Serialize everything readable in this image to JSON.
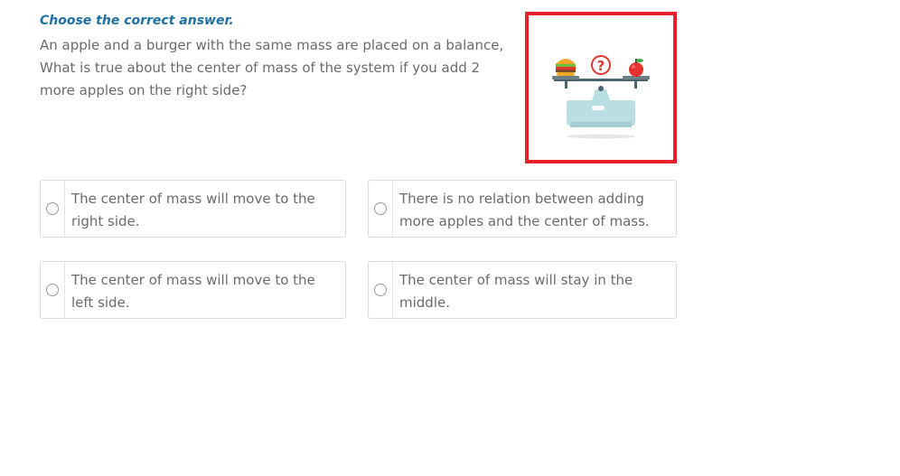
{
  "question": {
    "instruction": "Choose the correct answer.",
    "text": "An apple and a burger with the same mass are placed on a balance, What is true about the center of mass of the system if you add 2 more apples on the right side?",
    "image_icon": "balance-scale-burger-apple-question",
    "question_mark": "?",
    "frame_color": "#e8202a"
  },
  "options": [
    {
      "label": "The center of mass will move to the right side.",
      "selected": false
    },
    {
      "label": "There is no relation between adding more apples and the center of mass.",
      "selected": false
    },
    {
      "label": "The center of mass will move to the left side.",
      "selected": false
    },
    {
      "label": "The center of mass will stay in the middle.",
      "selected": false
    }
  ]
}
